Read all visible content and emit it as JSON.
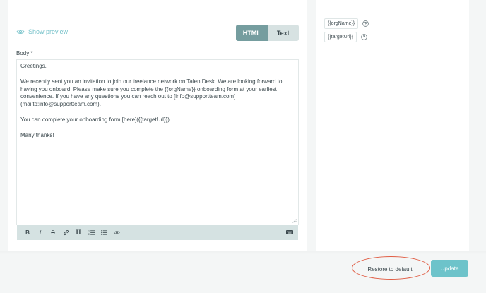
{
  "preview": {
    "label": "Show preview"
  },
  "format_toggle": {
    "html_label": "HTML",
    "text_label": "Text",
    "active": "HTML"
  },
  "body_field": {
    "label": "Body *",
    "paragraphs": [
      "Greetings,",
      "We recently sent you an invitation to join our freelance network on TalentDesk. We are looking forward to having you onboard. Please make sure you complete the {{orgName}} onboarding form at your earliest convenience. If you have any questions you can reach out to [info@supportteam.com](mailto:info@supportteam.com).",
      "You can complete your onboarding form [here]({{targetUrl}}).",
      "Many thanks!"
    ]
  },
  "toolbar": {
    "bold": "B",
    "italic": "I",
    "strike": "S",
    "heading": "H"
  },
  "variables": [
    {
      "name": "{{orgName}}"
    },
    {
      "name": "{{targetUrl}}"
    }
  ],
  "actions": {
    "restore_label": "Restore to default",
    "update_label": "Update"
  },
  "colors": {
    "accent": "#6dc3ca",
    "toggle_active": "#759d9f",
    "highlight_oval": "#e05c43"
  }
}
